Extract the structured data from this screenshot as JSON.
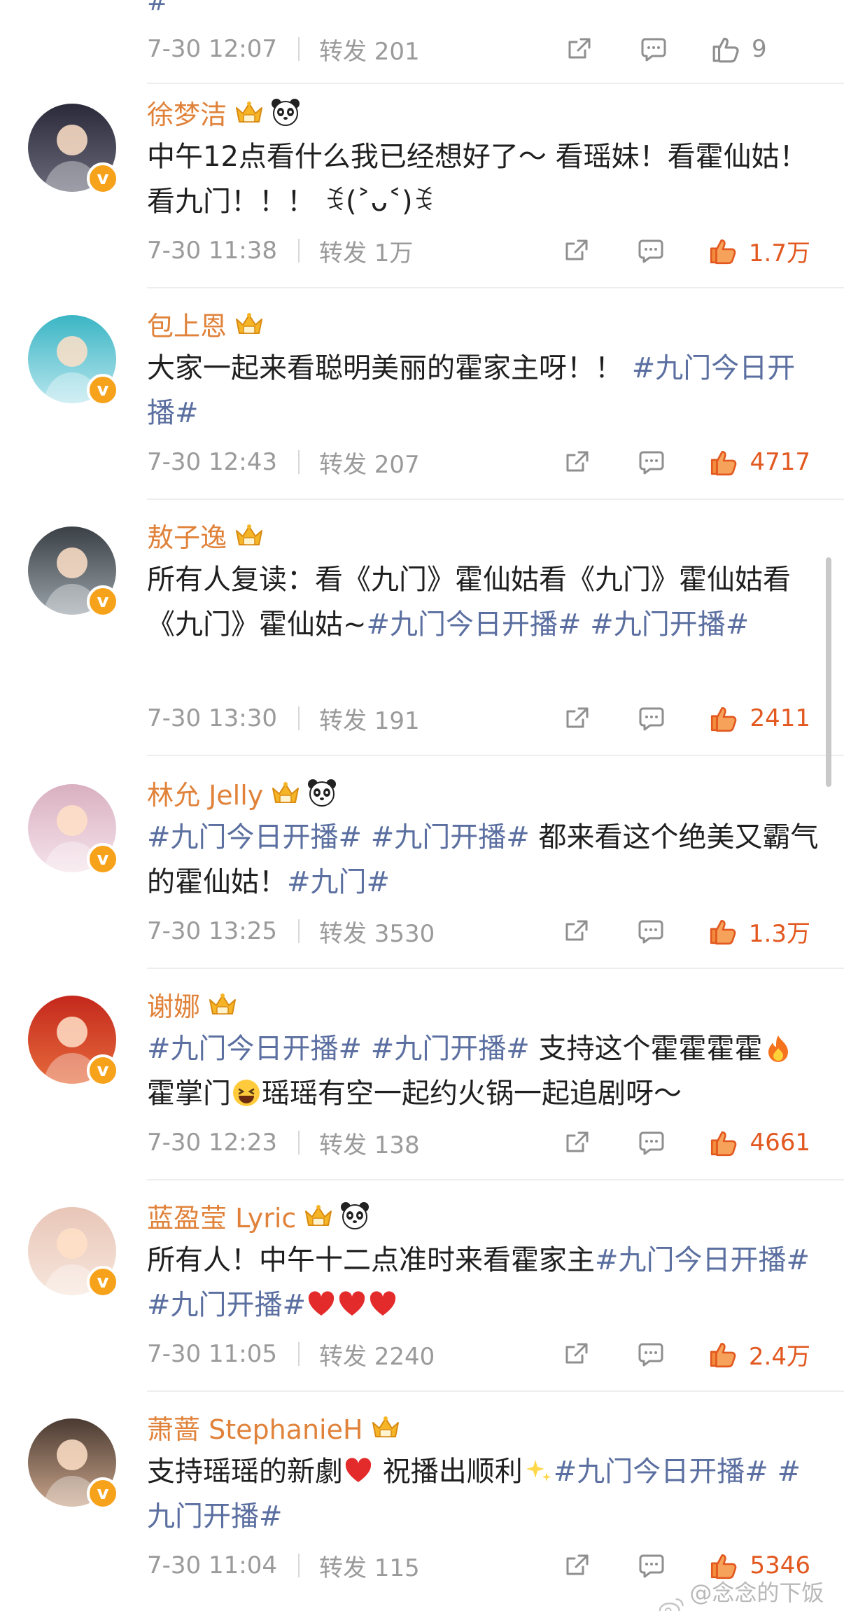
{
  "stub": {
    "hash_text": "#",
    "time": "7-30 12:07",
    "forward": "转发 201",
    "likes": "9"
  },
  "posts": [
    {
      "name": "徐梦洁",
      "badges": [
        "crown-icon",
        "panda-icon"
      ],
      "body_parts": [
        {
          "t": "text",
          "v": "中午12点看什么我已经想好了～ 看瑶妹！看霍仙姑！看九门！！！ "
        },
        {
          "t": "text",
          "v": "ꉂ(˃ᴗ˂)ꉂ"
        }
      ],
      "time": "7-30 11:38",
      "forward": "转发 1万",
      "likes": "1.7万"
    },
    {
      "name": "包上恩",
      "badges": [
        "crown-icon"
      ],
      "body_parts": [
        {
          "t": "text",
          "v": "大家一起来看聪明美丽的霍家主呀！！ "
        },
        {
          "t": "tag",
          "v": "#九门今日开播#"
        }
      ],
      "time": "7-30 12:43",
      "forward": "转发 207",
      "likes": "4717"
    },
    {
      "name": "敖子逸",
      "badges": [
        "crown-icon"
      ],
      "body_parts": [
        {
          "t": "text",
          "v": "所有人复读：看《九门》霍仙姑看《九门》霍仙姑看《九门》霍仙姑~"
        },
        {
          "t": "tag",
          "v": "#九门今日开播#"
        },
        {
          "t": "text",
          "v": " "
        },
        {
          "t": "tag",
          "v": "#九门开播#"
        }
      ],
      "time": "7-30 13:30",
      "forward": "转发 191",
      "likes": "2411"
    },
    {
      "name": "林允 Jelly",
      "badges": [
        "crown-icon",
        "panda-icon"
      ],
      "body_parts": [
        {
          "t": "tag",
          "v": "#九门今日开播#"
        },
        {
          "t": "text",
          "v": " "
        },
        {
          "t": "tag",
          "v": "#九门开播#"
        },
        {
          "t": "text",
          "v": " 都来看这个绝美又霸气的霍仙姑！"
        },
        {
          "t": "tag",
          "v": "#九门#"
        }
      ],
      "time": "7-30 13:25",
      "forward": "转发 3530",
      "likes": "1.3万"
    },
    {
      "name": "谢娜",
      "badges": [
        "crown-icon"
      ],
      "body_parts": [
        {
          "t": "tag",
          "v": "#九门今日开播#"
        },
        {
          "t": "text",
          "v": " "
        },
        {
          "t": "tag",
          "v": "#九门开播#"
        },
        {
          "t": "text",
          "v": " 支持这个霍霍霍霍"
        },
        {
          "t": "emoji",
          "v": "fire-emoji"
        },
        {
          "t": "text",
          "v": "霍掌门"
        },
        {
          "t": "emoji",
          "v": "grin-emoji"
        },
        {
          "t": "text",
          "v": "瑶瑶有空一起约火锅一起追剧呀～"
        }
      ],
      "time": "7-30 12:23",
      "forward": "转发 138",
      "likes": "4661"
    },
    {
      "name": "蓝盈莹 Lyric",
      "badges": [
        "crown-icon",
        "panda-icon"
      ],
      "body_parts": [
        {
          "t": "text",
          "v": "所有人！中午十二点准时来看霍家主"
        },
        {
          "t": "tag",
          "v": "#九门今日开播#"
        },
        {
          "t": "text",
          "v": " "
        },
        {
          "t": "tag",
          "v": "#九门开播#"
        },
        {
          "t": "emoji",
          "v": "heart-emoji"
        },
        {
          "t": "emoji",
          "v": "heart-emoji"
        },
        {
          "t": "emoji",
          "v": "heart-emoji"
        }
      ],
      "time": "7-30 11:05",
      "forward": "转发 2240",
      "likes": "2.4万"
    },
    {
      "name": "萧蔷 StephanieH",
      "badges": [
        "crown-icon"
      ],
      "body_parts": [
        {
          "t": "text",
          "v": "支持瑶瑶的新劇"
        },
        {
          "t": "emoji",
          "v": "heart-emoji"
        },
        {
          "t": "text",
          "v": " 祝播出顺利"
        },
        {
          "t": "emoji",
          "v": "sparkles-emoji"
        },
        {
          "t": "tag",
          "v": "#九门今日开播#"
        },
        {
          "t": "text",
          "v": " "
        },
        {
          "t": "tag",
          "v": "#九门开播#"
        }
      ],
      "time": "7-30 11:04",
      "forward": "转发 115",
      "likes": "5346"
    }
  ],
  "watermark": "@念念的下饭剧",
  "colors": {
    "name": "#e0823a",
    "tag": "#5b6fa0",
    "like_hot": "#e2581f",
    "meta": "#9a9a9a",
    "verified_badge": "#f7a21b"
  }
}
